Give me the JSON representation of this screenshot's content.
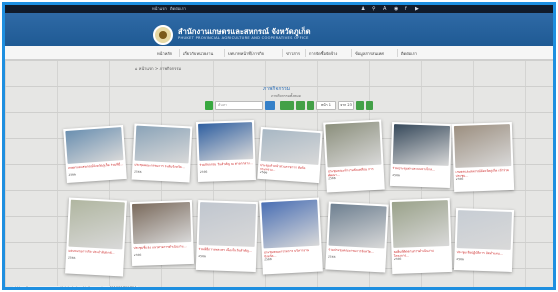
{
  "topbar": {
    "links": [
      "หน้าแรก",
      "ติดต่อเรา"
    ],
    "icons": [
      "user-icon",
      "search-icon",
      "text-size-icon",
      "eye-icon",
      "facebook-icon",
      "youtube-icon"
    ]
  },
  "header": {
    "title": "สำนักงานเกษตรและสหกรณ์ จังหวัดภูเก็ต",
    "subtitle": "PHUKET PROVINCIAL AGRICULTURE AND COOPERATIVES OFFICE"
  },
  "nav": {
    "items": [
      "หน้าหลัก",
      "เกี่ยวกับหน่วยงาน",
      "บทบาทหน้าที่/ภารกิจ",
      "ข่าวสาร",
      "การจัดซื้อจัดจ้าง",
      "ข้อมูลสารสนเทศ",
      "ติดต่อเรา"
    ]
  },
  "breadcrumb": "⌂ หน้าแรก > ภาพกิจกรรม",
  "section": {
    "title": "ภาพกิจกรรม",
    "subtitle": "ภาพกิจกรรมทั้งหมด"
  },
  "controls": {
    "search_placeholder": "ค้นหา",
    "page_current": "หน้า 1",
    "page_total": "จาก 23"
  },
  "cards": [
    {
      "caption": "เกษตรและสหกรณ์จังหวัดภูเก็ต ร่วมพิธี...",
      "sub": "2566",
      "photo": "#6a8fb0"
    },
    {
      "caption": "ประชุมคณะกรรมการ ระดับจังหวัด...",
      "sub": "2566",
      "photo": "#8aa3b8"
    },
    {
      "caption": "ร่วมกิจกรรม วันสำคัญ ณ ศาลากลาง...",
      "sub": "2566",
      "photo": "#2f5fa0"
    },
    {
      "caption": "ประชุมหัวหน้าส่วนราชการ สังกัดกระทรวง...",
      "sub": "2566",
      "photo": "#a7b7c4"
    },
    {
      "caption": "ประชุมคณะทำงานขับเคลื่อน การพัฒนา...",
      "sub": "2566",
      "photo": "#8b8f7c"
    },
    {
      "caption": "ร่วมประชุมผ่านระบบทางไกล...",
      "sub": "2566",
      "photo": "#35485a"
    },
    {
      "caption": "เกษตรและสหกรณ์จังหวัดภูเก็ต เข้าร่วมประชุม...",
      "sub": "2566",
      "photo": "#9c8f80"
    },
    {
      "caption": "มอบหมายภารกิจ ประจำสัปดาห์...",
      "sub": "2566",
      "photo": "#b0b6a0"
    },
    {
      "caption": "ประชุมชี้แจง แนวทางการดำเนินงาน...",
      "sub": "2566",
      "photo": "#7a6a5c"
    },
    {
      "caption": "ร่วมพิธีถวายพระพร เนื่องในวันสำคัญ...",
      "sub": "2566",
      "photo": "#c0c6cf"
    },
    {
      "caption": "ประชุมคณะกรรมการ บริหารงานจังหวัด...",
      "sub": "2566",
      "photo": "#4a6fb4"
    },
    {
      "caption": "ร่วมประชุมคณะกรมการจังหวัด...",
      "sub": "2566",
      "photo": "#6d7f90"
    },
    {
      "caption": "ลงพื้นที่ติดตามการดำเนินงาน โครงการ...",
      "sub": "2566",
      "photo": "#9aa28a"
    },
    {
      "caption": "ประชุมเชิงปฏิบัติการ จัดทำแผน...",
      "sub": "2566",
      "photo": "#c7cdd4"
    }
  ],
  "status_url": "https://www.opsmoac.go.th/phuket-activity-preview-411991791794"
}
